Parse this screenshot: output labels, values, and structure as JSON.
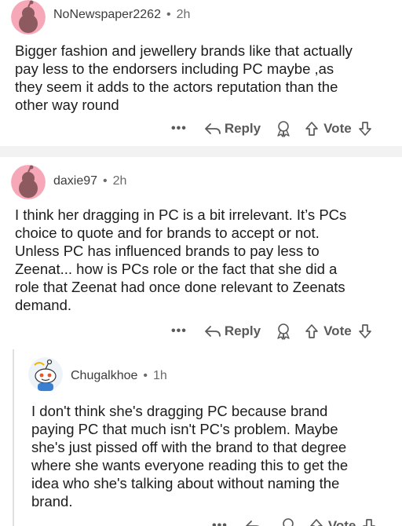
{
  "comments": [
    {
      "username": "NoNewspaper2262",
      "separator": "•",
      "time": "2h",
      "lines": [
        "Bigger fashion and jewellery brands like that actually",
        "pay less to the endorsers including PC maybe ,as",
        "they seem it adds to the actors reputation  than the",
        "other way round"
      ],
      "more": "•••",
      "reply": "Reply",
      "vote": "Vote"
    },
    {
      "username": "daxie97",
      "separator": "•",
      "time": "2h",
      "lines": [
        "I think her dragging in PC is a bit irrelevant. It’s PCs",
        "choice to quote and for brands to accept or not.",
        "Unless PC has influenced brands to pay less to",
        "Zeenat... how is PCs role or the fact that she did a",
        "role that Zeenat had once done relevant to Zeenats",
        "demand."
      ],
      "more": "•••",
      "reply": "Reply",
      "vote": "Vote"
    },
    {
      "username": "Chugalkhoe",
      "separator": "•",
      "time": "1h",
      "lines": [
        "I don't think she's dragging PC because brand",
        "paying PC that much isn't PC's problem. Maybe",
        "she's just pissed off with the brand to that degree",
        "where she wants everyone reading this to get the",
        "idea who she's talking about without naming the",
        "brand."
      ],
      "more": "•••",
      "reply": "Reply",
      "vote": "Vote"
    }
  ],
  "colors": {
    "avatar_bg": "#f7a8b8",
    "avatar_figure": "#8c5a5f",
    "divider": "#f2f2f2",
    "action_text": "#5a5a5a"
  },
  "icons": [
    "reply-arrow-icon",
    "award-icon",
    "upvote-icon",
    "downvote-icon",
    "more-options-icon"
  ]
}
